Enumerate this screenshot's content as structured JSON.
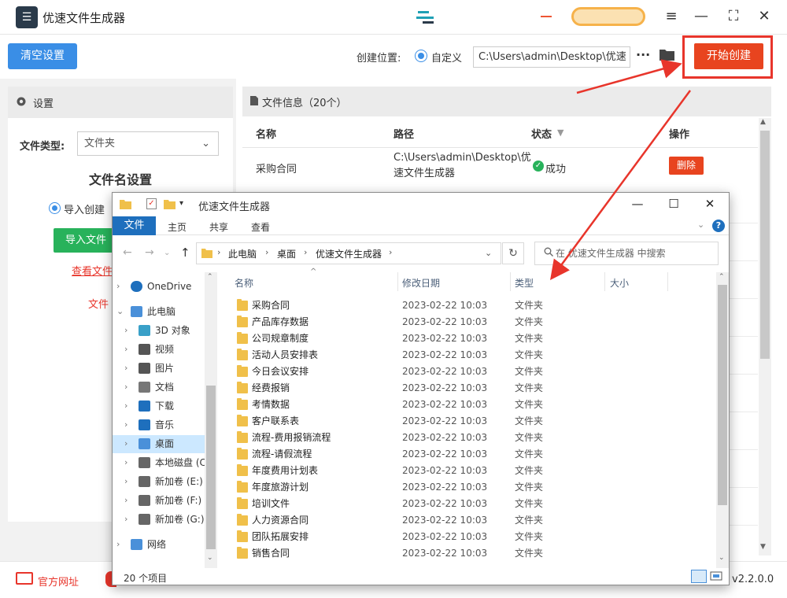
{
  "app": {
    "title": "优速文件生成器",
    "version": "v2.2.0.0"
  },
  "toolbar": {
    "clear_label": "清空设置",
    "location_label": "创建位置:",
    "custom_label": "自定义",
    "path_value": "C:\\Users\\admin\\Desktop\\优速",
    "start_label": "开始创建"
  },
  "settings": {
    "header": "设置",
    "file_type_label": "文件类型:",
    "file_type_value": "文件夹",
    "filename_heading": "文件名设置",
    "import_radio_label": "导入创建",
    "import_button_label": "导入文件",
    "view_link": "查看文件",
    "note_text": "文件"
  },
  "file_info": {
    "header": "文件信息（20个）",
    "columns": {
      "name": "名称",
      "path": "路径",
      "status": "状态",
      "action": "操作"
    },
    "rows": [
      {
        "name": "采购合同",
        "path": "C:\\Users\\admin\\Desktop\\优速文件生成器",
        "status": "成功",
        "action": "删除"
      }
    ]
  },
  "footer": {
    "website_label": "官方网址"
  },
  "explorer": {
    "title": "优速文件生成器",
    "tabs": [
      "文件",
      "主页",
      "共享",
      "查看"
    ],
    "breadcrumb": [
      "此电脑",
      "桌面",
      "优速文件生成器"
    ],
    "search_placeholder": "在 优速文件生成器 中搜索",
    "nav_items": [
      {
        "label": "OneDrive",
        "icon": "cloud-icon"
      },
      {
        "label": "此电脑",
        "icon": "computer-icon"
      },
      {
        "label": "3D 对象",
        "icon": "cube-icon"
      },
      {
        "label": "视频",
        "icon": "video-icon"
      },
      {
        "label": "图片",
        "icon": "picture-icon"
      },
      {
        "label": "文档",
        "icon": "document-icon"
      },
      {
        "label": "下载",
        "icon": "download-icon"
      },
      {
        "label": "音乐",
        "icon": "music-icon"
      },
      {
        "label": "桌面",
        "icon": "desktop-icon"
      },
      {
        "label": "本地磁盘 (C",
        "icon": "drive-icon"
      },
      {
        "label": "新加卷 (E:)",
        "icon": "drive-icon"
      },
      {
        "label": "新加卷 (F:)",
        "icon": "drive-icon"
      },
      {
        "label": "新加卷 (G:)",
        "icon": "drive-icon"
      },
      {
        "label": "网络",
        "icon": "network-icon"
      }
    ],
    "columns": {
      "name": "名称",
      "date": "修改日期",
      "type": "类型",
      "size": "大小"
    },
    "files": [
      {
        "name": "采购合同",
        "date": "2023-02-22 10:03",
        "type": "文件夹"
      },
      {
        "name": "产品库存数据",
        "date": "2023-02-22 10:03",
        "type": "文件夹"
      },
      {
        "name": "公司规章制度",
        "date": "2023-02-22 10:03",
        "type": "文件夹"
      },
      {
        "name": "活动人员安排表",
        "date": "2023-02-22 10:03",
        "type": "文件夹"
      },
      {
        "name": "今日会议安排",
        "date": "2023-02-22 10:03",
        "type": "文件夹"
      },
      {
        "name": "经费报销",
        "date": "2023-02-22 10:03",
        "type": "文件夹"
      },
      {
        "name": "考情数据",
        "date": "2023-02-22 10:03",
        "type": "文件夹"
      },
      {
        "name": "客户联系表",
        "date": "2023-02-22 10:03",
        "type": "文件夹"
      },
      {
        "name": "流程-费用报销流程",
        "date": "2023-02-22 10:03",
        "type": "文件夹"
      },
      {
        "name": "流程-请假流程",
        "date": "2023-02-22 10:03",
        "type": "文件夹"
      },
      {
        "name": "年度费用计划表",
        "date": "2023-02-22 10:03",
        "type": "文件夹"
      },
      {
        "name": "年度旅游计划",
        "date": "2023-02-22 10:03",
        "type": "文件夹"
      },
      {
        "name": "培训文件",
        "date": "2023-02-22 10:03",
        "type": "文件夹"
      },
      {
        "name": "人力资源合同",
        "date": "2023-02-22 10:03",
        "type": "文件夹"
      },
      {
        "name": "团队拓展安排",
        "date": "2023-02-22 10:03",
        "type": "文件夹"
      },
      {
        "name": "销售合同",
        "date": "2023-02-22 10:03",
        "type": "文件夹"
      }
    ],
    "item_count": "20 个项目"
  },
  "colors": {
    "accent_blue": "#3a8ee6",
    "start_red": "#e8441f",
    "success_green": "#28b25b",
    "annotation_red": "#e8352b"
  }
}
